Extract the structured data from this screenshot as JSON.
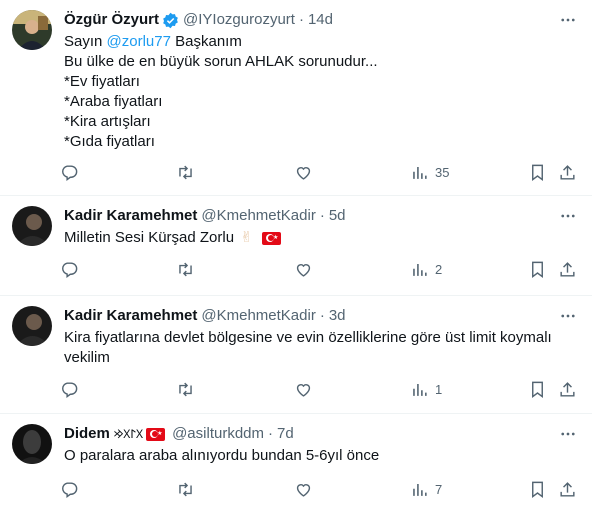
{
  "tweets": [
    {
      "name": "Özgür Özyurt",
      "handle": "@IYIozgurozyurt",
      "time": "14d",
      "verified": true,
      "mention": "@zorlu77",
      "lines": [
        "Sayın",
        "Başkanım",
        "Bu ülke de en büyük sorun AHLAK sorunudur...",
        "*Ev fiyatları",
        "*Araba fiyatları",
        "*Kira artışları",
        "*Gıda fiyatları"
      ],
      "views": "35"
    },
    {
      "name": "Kadir Karamehmet",
      "handle": "@KmehmetKadir",
      "time": "5d",
      "text": "Milletin Sesi Kürşad Zorlu",
      "views": "2"
    },
    {
      "name": "Kadir Karamehmet",
      "handle": "@KmehmetKadir",
      "time": "3d",
      "lines": [
        "Kira fiyatlarına devlet bölgesine ve evin özelliklerine göre üst limit koymalı",
        "vekilim"
      ],
      "views": "1"
    },
    {
      "name": "Didem",
      "name_suffix": "𐰓𐰃𐰓𐰢",
      "handle": "@asilturkddm",
      "time": "7d",
      "text": "O paralara araba alınıyordu bundan 5-6yıl önce",
      "views": "7"
    }
  ],
  "icons": {
    "reply": "reply-icon",
    "retweet": "retweet-icon",
    "like": "heart-icon",
    "views": "views-icon",
    "bookmark": "bookmark-icon",
    "share": "share-icon",
    "more": "more-icon",
    "verified": "verified-badge-icon"
  },
  "colors": {
    "link": "#1d9bf0",
    "muted": "#536471",
    "text": "#0f1419"
  }
}
